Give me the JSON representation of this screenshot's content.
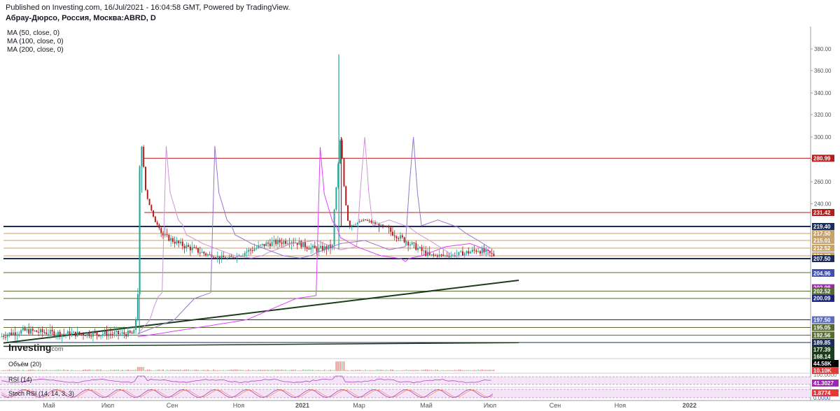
{
  "header": {
    "published": "Published on Investing.com, 16/Jul/2021 - 16:04:58 GMT, Powered by TradingView.",
    "symbol": "Абрау-Дюрсо, Россия, Москва:ABRD, D"
  },
  "indicators": [
    "MA (50, close, 0)",
    "MA (100, close, 0)",
    "MA (200, close, 0)"
  ],
  "logo": {
    "brand": "Investing",
    "suffix": ".com"
  },
  "colors": {
    "up": "#26a69a",
    "down": "#b71c1c",
    "ma50": "#ce93d8",
    "ma100": "#9575cd",
    "ma200": "#e040fb",
    "trend": "#1b3d1b",
    "resistance": "#b71c1c",
    "support_band": "#c8a26b",
    "pane_fill": "#f3e5f5",
    "rsi_line": "#ab47bc",
    "stoch_k": "#ab47bc",
    "stoch_d": "#ff7043"
  },
  "chart_data": {
    "type": "candlestick",
    "x_ticks": [
      "Май",
      "Июл",
      "Сен",
      "Ноя",
      "2021",
      "Мар",
      "Май",
      "Июл",
      "Сен",
      "Ноя",
      "2022"
    ],
    "y_ticks": [
      "380.00",
      "360.00",
      "340.00",
      "320.00",
      "300.00",
      "280.00",
      "260.00",
      "240.00"
    ],
    "ylim": [
      168,
      392
    ],
    "price_levels": [
      {
        "label": "280.99",
        "value": 280.99,
        "color": "#b71c1c",
        "kind": "resistance"
      },
      {
        "label": "231.42",
        "value": 231.42,
        "color": "#b71c1c",
        "kind": "resistance"
      },
      {
        "label": "219.40",
        "value": 219.4,
        "color": "#1a2b5c",
        "kind": "channel"
      },
      {
        "label": "217.50",
        "value": 217.5,
        "color": "#c8a26b",
        "kind": "support"
      },
      {
        "label": "215.01",
        "value": 215.01,
        "color": "#c8a26b",
        "kind": "support"
      },
      {
        "label": "212.52",
        "value": 212.52,
        "color": "#c8a26b",
        "kind": "support"
      },
      {
        "label": "210.03",
        "value": 210.03,
        "color": "#c8a26b",
        "kind": "support"
      },
      {
        "label": "207.50",
        "value": 207.5,
        "color": "#1a2b5c",
        "kind": "channel"
      },
      {
        "label": "205.05",
        "value": 205.05,
        "color": "#556b2f",
        "kind": "support"
      },
      {
        "label": "204.96",
        "value": 204.96,
        "color": "#3f51b5",
        "kind": "marker"
      },
      {
        "label": "202.98",
        "value": 202.98,
        "color": "#9c27b0",
        "kind": "marker"
      },
      {
        "label": "202.52",
        "value": 202.52,
        "color": "#556b2f",
        "kind": "support"
      },
      {
        "label": "199.99",
        "value": 199.99,
        "color": "#556b2f",
        "kind": "support"
      },
      {
        "label": "200.09",
        "value": 200.09,
        "color": "#1a237e",
        "kind": "marker"
      },
      {
        "label": "197.50",
        "value": 197.5,
        "color": "#1a2b5c",
        "kind": "support"
      },
      {
        "label": "197.50",
        "value": 197.5,
        "color": "#5c6bc0",
        "kind": "marker"
      },
      {
        "label": "195.05",
        "value": 195.05,
        "color": "#556b2f",
        "kind": "support"
      },
      {
        "label": "192.56",
        "value": 192.56,
        "color": "#556b2f",
        "kind": "support"
      },
      {
        "label": "189.85",
        "value": 189.85,
        "color": "#1a2b5c",
        "kind": "support"
      },
      {
        "label": "177.39",
        "value": 177.39,
        "color": "#1b3d1b",
        "kind": "marker"
      },
      {
        "label": "168.14",
        "value": 168.14,
        "color": "#1b3d1b",
        "kind": "marker"
      }
    ],
    "trendlines": [
      {
        "from": [
          0.0,
          189.0
        ],
        "to": [
          0.64,
          204.0
        ]
      },
      {
        "from": [
          0.0,
          183.0
        ],
        "to": [
          0.64,
          189.5
        ]
      }
    ],
    "approx_path": [
      [
        0.0,
        192
      ],
      [
        0.01,
        193
      ],
      [
        0.03,
        194
      ],
      [
        0.08,
        193
      ],
      [
        0.14,
        193
      ],
      [
        0.165,
        193
      ],
      [
        0.17,
        202
      ],
      [
        0.172,
        270
      ],
      [
        0.175,
        292
      ],
      [
        0.18,
        250
      ],
      [
        0.19,
        225
      ],
      [
        0.2,
        217
      ],
      [
        0.22,
        214
      ],
      [
        0.25,
        211
      ],
      [
        0.28,
        208
      ],
      [
        0.3,
        211
      ],
      [
        0.33,
        214
      ],
      [
        0.36,
        215
      ],
      [
        0.39,
        212
      ],
      [
        0.41,
        213
      ],
      [
        0.42,
        300
      ],
      [
        0.425,
        250
      ],
      [
        0.43,
        220
      ],
      [
        0.45,
        225
      ],
      [
        0.47,
        220
      ],
      [
        0.5,
        215
      ],
      [
        0.53,
        210
      ],
      [
        0.56,
        210
      ],
      [
        0.59,
        212
      ],
      [
        0.61,
        210
      ]
    ],
    "volume_pane": {
      "label": "Объём (20)",
      "value_label": "44.58K",
      "secondary_label": "10.10K"
    },
    "rsi_pane": {
      "label": "RSI (14)",
      "value_label": "41.3027",
      "top_label": "100.0000"
    },
    "stoch_pane": {
      "label": "Stoch RSI (14, 14, 3, 3)",
      "value_label": "1.8774",
      "bottom_label": "0.0000"
    }
  }
}
